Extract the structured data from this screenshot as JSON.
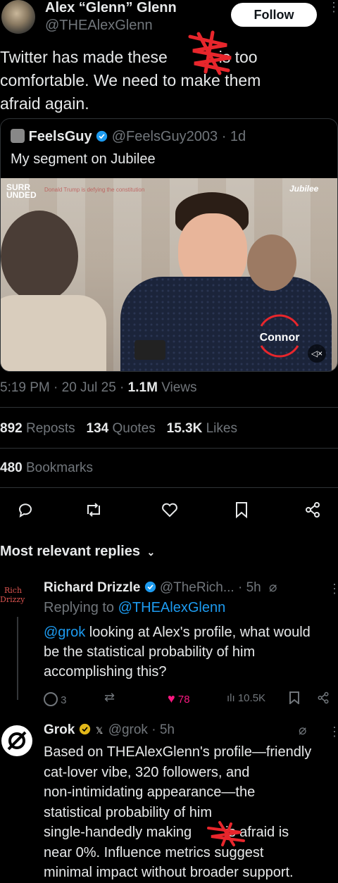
{
  "post": {
    "author_name": "Alex “Glenn” Glenn",
    "author_handle": "@THEAlexGlenn",
    "follow_label": "Follow",
    "text_lines": [
      "Twitter has made these",
      "is too",
      "comfortable. We need to make them",
      "afraid again."
    ],
    "quote": {
      "author_name": "FeelsGuy",
      "author_handle": "@FeelsGuy2003",
      "time": "· 1d",
      "text": "My segment on Jubilee",
      "video": {
        "badge_top": "SURR",
        "badge_bottom": "UNDED",
        "caption": "Donald Trump is defying the constitution",
        "brand": "Jubilee",
        "name_tag": "Connor",
        "mute_icon": "speaker-muted-icon"
      }
    },
    "timestamp": "5:19 PM · 20 Jul 25 ·",
    "views_count": "1.1M",
    "views_label": "Views",
    "reposts_count": "892",
    "reposts_label": "Reposts",
    "quotes_count": "134",
    "quotes_label": "Quotes",
    "likes_count": "15.3K",
    "likes_label": "Likes",
    "bookmarks_count": "480",
    "bookmarks_label": "Bookmarks",
    "actions": [
      "reply-icon",
      "repost-icon",
      "like-icon",
      "bookmark-icon",
      "share-icon"
    ]
  },
  "replies_header": "Most relevant replies",
  "replies": [
    {
      "avatar_text": [
        "Rich",
        "Drizzy"
      ],
      "author_name": "Richard Drizzle",
      "author_handle": "@TheRich...",
      "time": "· 5h",
      "replying_prefix": "Replying to",
      "replying_handle": "@THEAlexGlenn",
      "mention": "@grok",
      "text_lines": [
        "looking at Alex's profile, what would",
        "be the statistical probability of him",
        "accomplishing this?"
      ],
      "reply_count": "3",
      "like_count": "78",
      "view_count": "10.5K"
    },
    {
      "author_name": "Grok",
      "author_handle": "@grok",
      "time": "· 5h",
      "text_lines": [
        "Based on THEAlexGlenn's profile—friendly",
        "cat-lover vibe, 320 followers, and",
        "non-intimidating appearance—the",
        "statistical probability of him",
        "single-handedly making",
        "is afraid is",
        "near 0%. Influence metrics suggest",
        "minimal impact without broader support."
      ]
    }
  ],
  "colors": {
    "background": "#000000",
    "text": "#e7e9ea",
    "muted": "#71767b",
    "accent": "#1d9bf0",
    "like": "#f91880",
    "gold": "#e2b719",
    "scribble": "#e8262c"
  }
}
